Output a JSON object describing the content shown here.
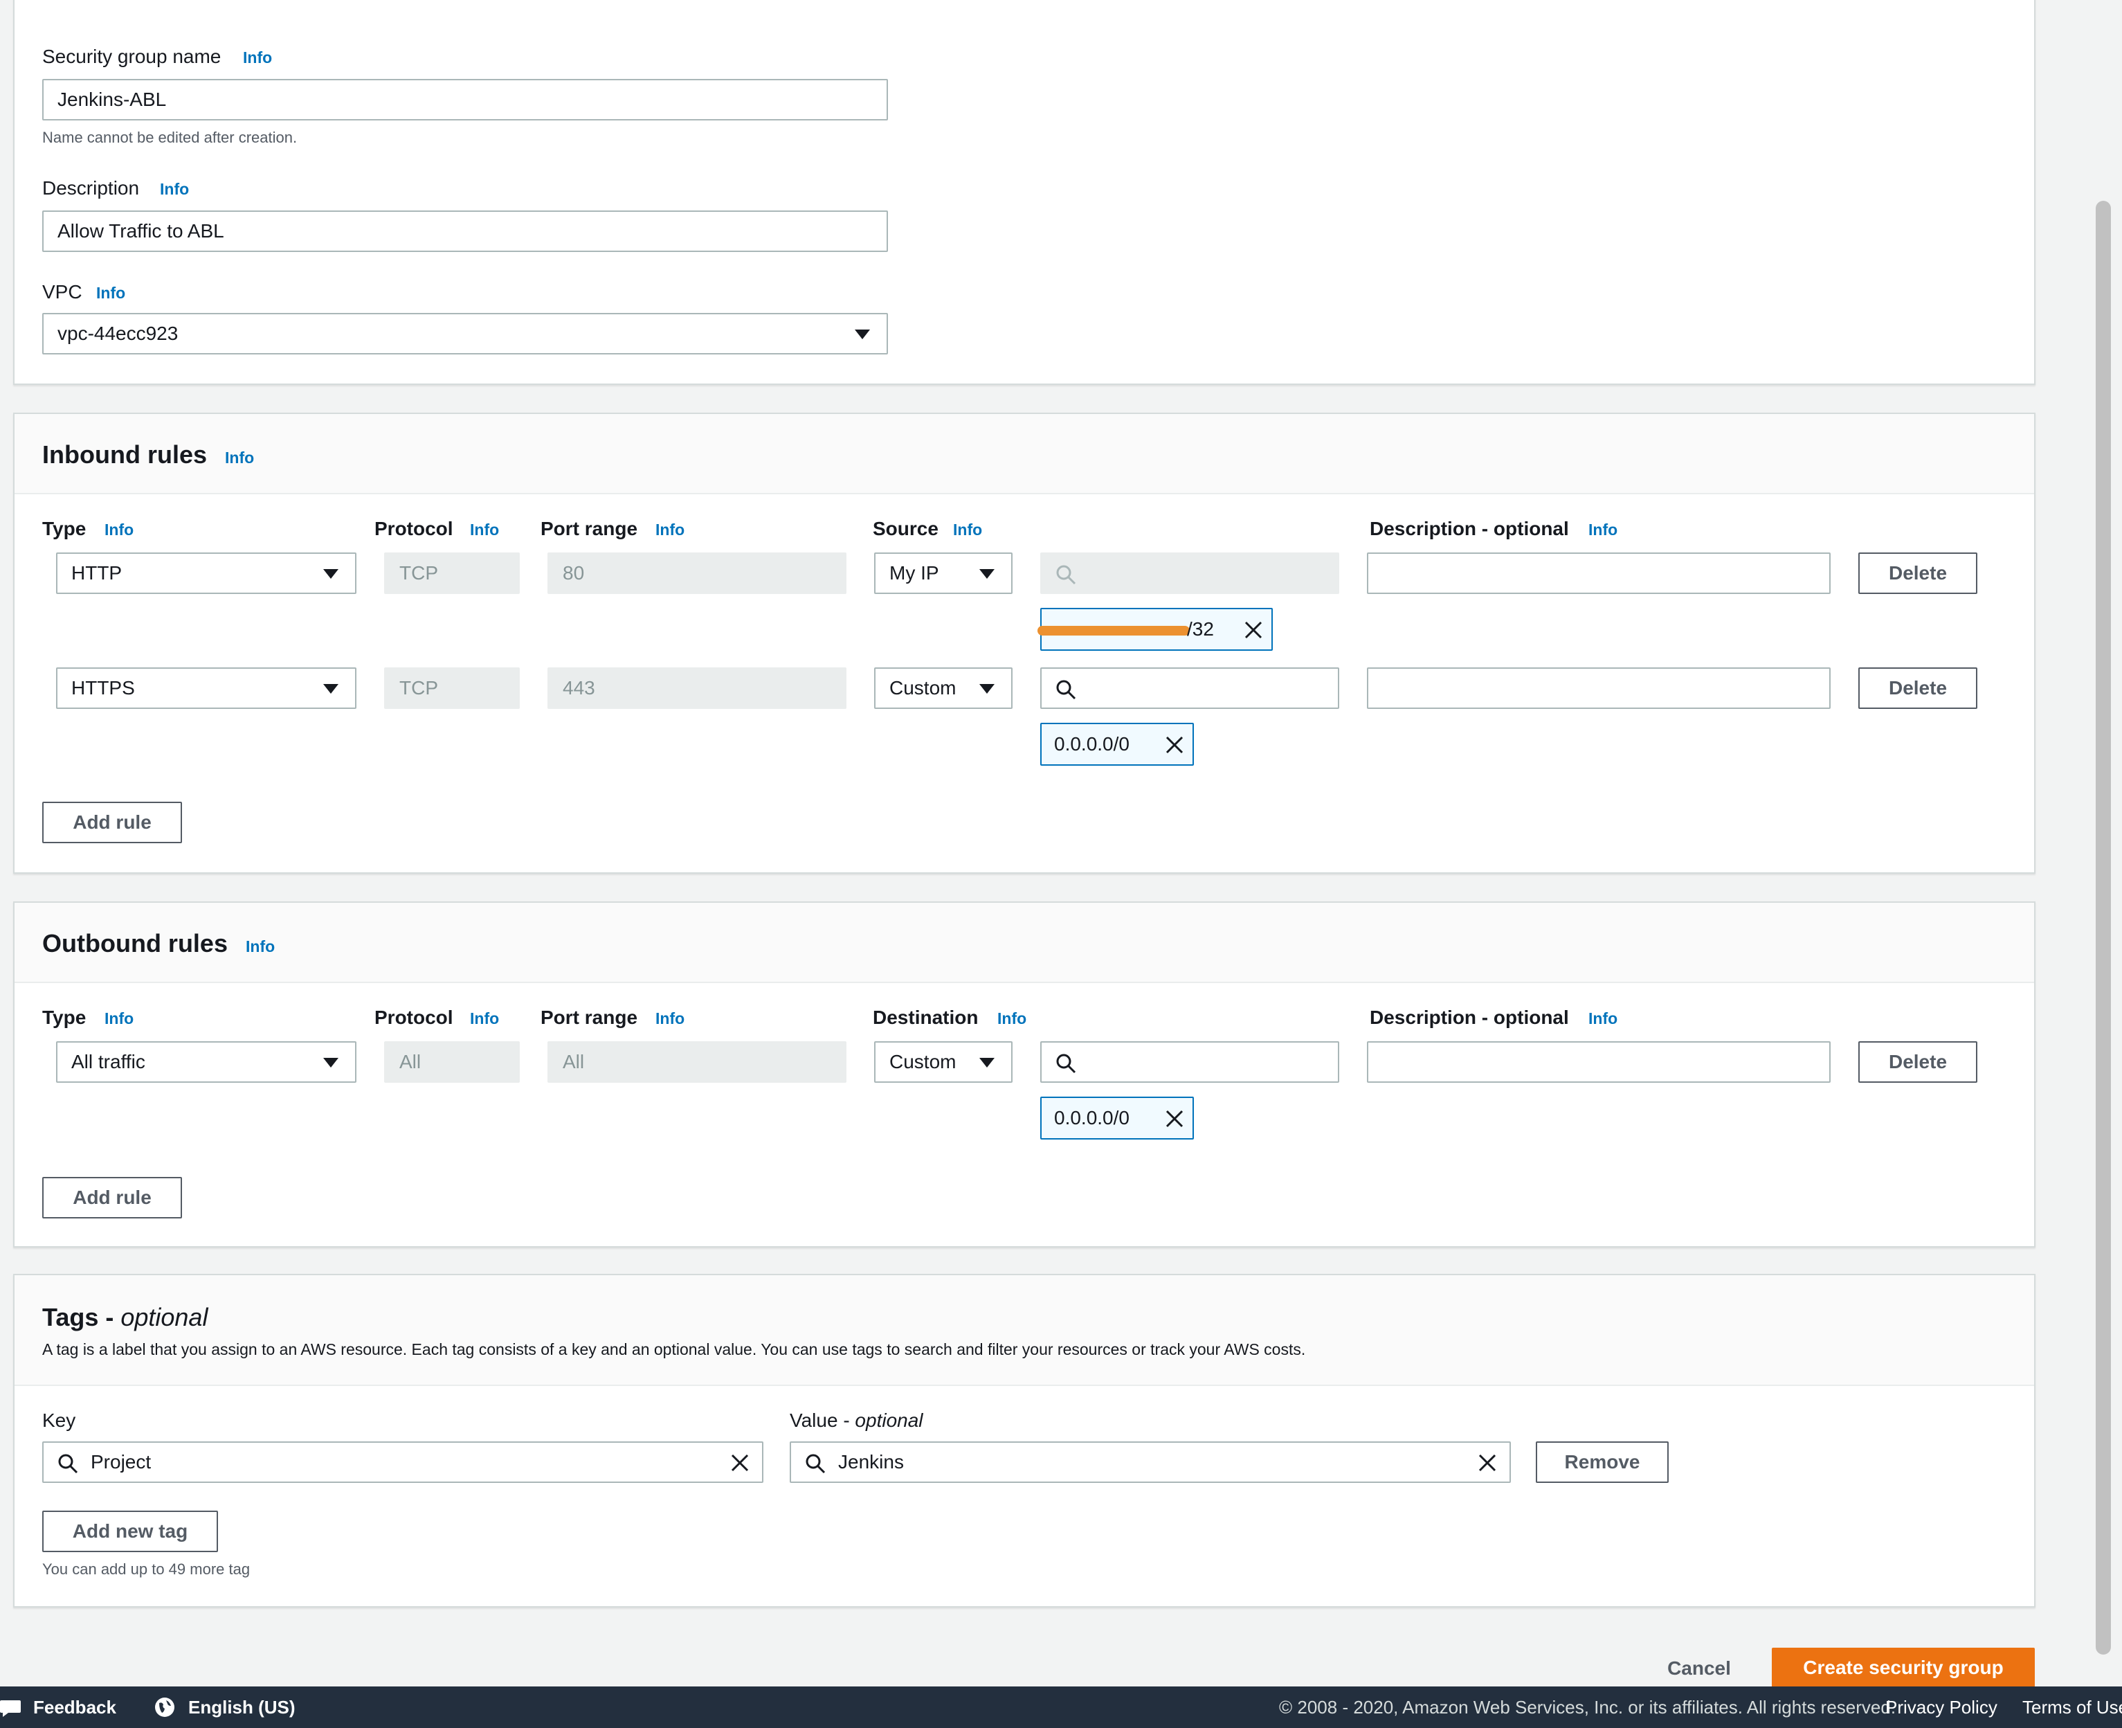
{
  "info_label": "Info",
  "basic": {
    "name_label": "Security group name",
    "name_value": "Jenkins-ABL",
    "name_hint": "Name cannot be edited after creation.",
    "desc_label": "Description",
    "desc_value": "Allow Traffic to ABL",
    "vpc_label": "VPC",
    "vpc_value": "vpc-44ecc923"
  },
  "inbound": {
    "title": "Inbound rules",
    "columns": {
      "type": "Type",
      "protocol": "Protocol",
      "port_range": "Port range",
      "source": "Source",
      "description": "Description - optional"
    },
    "rules": [
      {
        "type": "HTTP",
        "protocol": "TCP",
        "port": "80",
        "source": "My IP",
        "cidr": "/32"
      },
      {
        "type": "HTTPS",
        "protocol": "TCP",
        "port": "443",
        "source": "Custom",
        "cidr": "0.0.0.0/0"
      }
    ],
    "delete_label": "Delete",
    "add_rule_label": "Add rule"
  },
  "outbound": {
    "title": "Outbound rules",
    "columns": {
      "type": "Type",
      "protocol": "Protocol",
      "port_range": "Port range",
      "destination": "Destination",
      "description": "Description - optional"
    },
    "rules": [
      {
        "type": "All traffic",
        "protocol": "All",
        "port": "All",
        "destination": "Custom",
        "cidr": "0.0.0.0/0"
      }
    ],
    "delete_label": "Delete",
    "add_rule_label": "Add rule"
  },
  "tags": {
    "title": "Tags - ",
    "title_optional": "optional",
    "description": "A tag is a label that you assign to an AWS resource. Each tag consists of a key and an optional value. You can use tags to search and filter your resources or track your AWS costs.",
    "key_label": "Key",
    "value_label": "Value - ",
    "value_optional": "optional",
    "key_value": "Project",
    "value_value": "Jenkins",
    "remove_label": "Remove",
    "add_tag_label": "Add new tag",
    "limit_hint": "You can add up to 49 more tag"
  },
  "actions": {
    "cancel_label": "Cancel",
    "create_label": "Create security group"
  },
  "footer": {
    "feedback": "Feedback",
    "language": "English (US)",
    "copyright": "© 2008 - 2020, Amazon Web Services, Inc. or its affiliates. All rights reserved.",
    "privacy": "Privacy Policy",
    "terms": "Terms of Use"
  },
  "colors": {
    "accent_link": "#0073bb",
    "primary_button": "#ec7211",
    "footer_bg": "#232f3e",
    "redaction": "#ec9130"
  }
}
